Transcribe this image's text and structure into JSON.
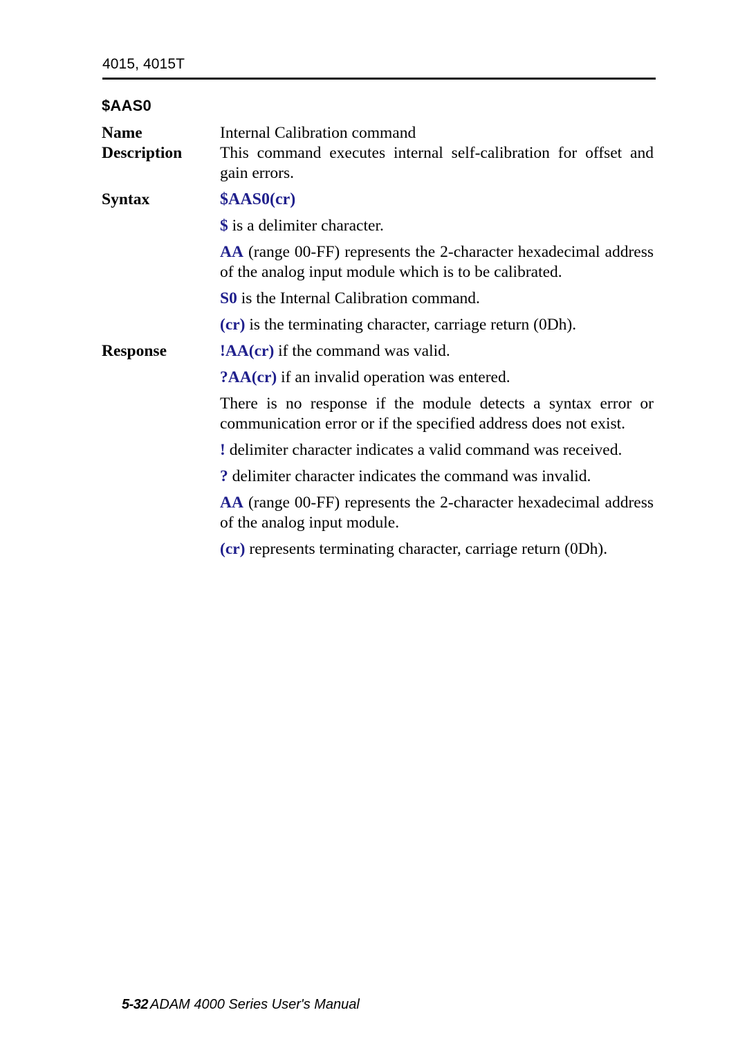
{
  "header": {
    "running_head": "4015, 4015T"
  },
  "command": {
    "title": "$AAS0"
  },
  "labels": {
    "name": "Name",
    "description": "Description",
    "syntax": "Syntax",
    "response": "Response"
  },
  "name_section": {
    "text": "Internal Calibration command"
  },
  "description_section": {
    "text": "This command executes internal self-calibration for offset and gain errors."
  },
  "syntax_section": {
    "command_line": "$AAS0(cr)",
    "dollar_kw": "$",
    "dollar_rest": " is a delimiter character.",
    "aa_kw": "AA",
    "aa_rest": " (range 00-FF) represents the 2-character hexadecimal address of the analog input module which is to be calibrated.",
    "s0_kw": "S0",
    "s0_rest": " is the Internal Calibration command.",
    "cr_kw": "(cr)",
    "cr_rest": " is the terminating character, carriage return (0Dh)."
  },
  "response_section": {
    "valid_kw": "!AA(cr)",
    "valid_rest": " if the command was valid.",
    "invalid_kw": "?AA(cr)",
    "invalid_rest": " if an invalid operation was entered.",
    "no_response_text": "There is no response if the module detects a syntax error or communication error or if the specified address does not exist.",
    "bang_kw": "!",
    "bang_rest": " delimiter character indicates a valid command was received.",
    "question_kw": "?",
    "question_rest": " delimiter character indicates the command was invalid.",
    "aa_kw": "AA",
    "aa_rest": " (range 00-FF) represents the 2-character hexadecimal address of the analog input module.",
    "cr_kw": "(cr)",
    "cr_rest": " represents terminating character, carriage return (0Dh)."
  },
  "footer": {
    "page_number": "5-32",
    "manual_title": "ADAM 4000 Series User's Manual"
  },
  "colors": {
    "keyword_blue": "#1f1f8c",
    "text_black": "#000000",
    "page_background": "#ffffff"
  }
}
